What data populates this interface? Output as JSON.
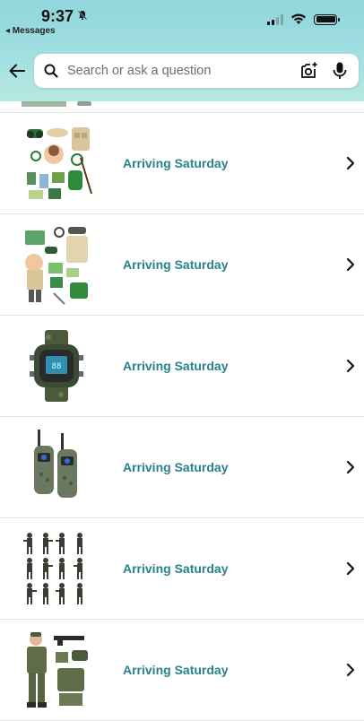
{
  "status_bar": {
    "time": "9:37",
    "back_label": "◂ Messages"
  },
  "search": {
    "placeholder": "Search or ask a question"
  },
  "items": [
    {
      "label": "Arriving Saturday",
      "product": "explorer kit with binoculars and vest"
    },
    {
      "label": "Arriving Saturday",
      "product": "explorer costume and accessories kit"
    },
    {
      "label": "Arriving Saturday",
      "product": "camo digital watch"
    },
    {
      "label": "Arriving Saturday",
      "product": "camo walkie talkies"
    },
    {
      "label": "Arriving Saturday",
      "product": "army men figures set"
    },
    {
      "label": "Arriving Saturday",
      "product": "soldier costume set"
    }
  ],
  "colors": {
    "accent": "#26838b",
    "header_top": "#8fd6dc",
    "header_bottom": "#b7e8e2"
  }
}
